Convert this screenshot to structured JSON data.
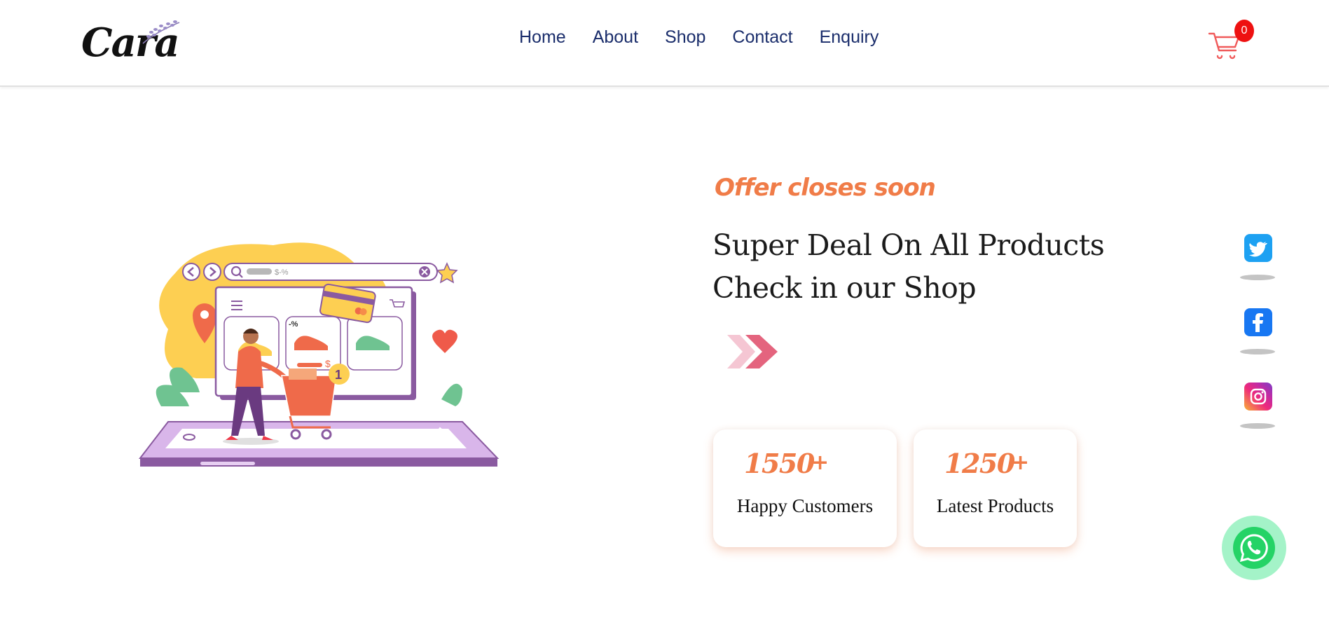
{
  "header": {
    "logo_text": "Cara",
    "nav": [
      "Home",
      "About",
      "Shop",
      "Contact",
      "Enquiry"
    ],
    "cart_count": "0"
  },
  "hero": {
    "offer": "Offer closes soon",
    "headline_line1": "Super Deal On All Products",
    "headline_line2": "Check in our Shop",
    "illustration_search_text": "$-%",
    "illustration_discount": "-%",
    "illustration_price": "$",
    "illustration_cart_count": "1"
  },
  "stats": [
    {
      "number": "1550",
      "plus": "+",
      "label": "Happy Customers"
    },
    {
      "number": "1250",
      "plus": "+",
      "label": "Latest Products"
    }
  ],
  "social": [
    "twitter-icon",
    "facebook-icon",
    "instagram-icon"
  ],
  "colors": {
    "accent": "#f07c48",
    "nav": "#1a2d6b",
    "cart": "#f05a5a",
    "badge": "#ee1111",
    "whatsapp": "#25d366"
  }
}
